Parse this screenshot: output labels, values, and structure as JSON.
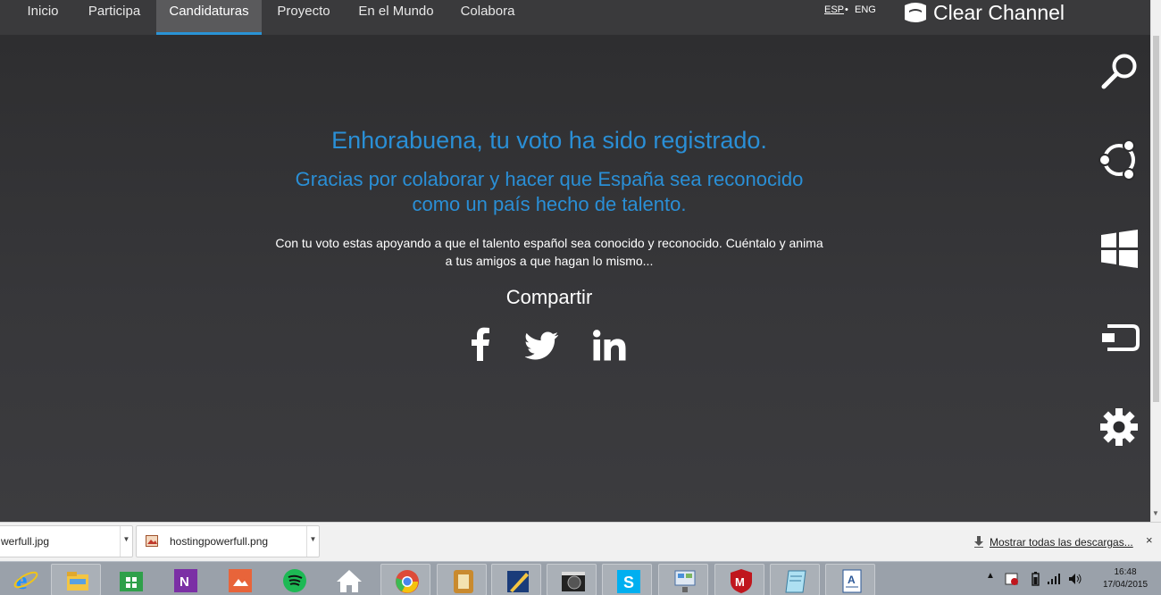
{
  "nav": {
    "items": [
      {
        "label": "Inicio"
      },
      {
        "label": "Participa"
      },
      {
        "label": "Candidaturas",
        "active": true
      },
      {
        "label": "Proyecto"
      },
      {
        "label": "En el Mundo"
      },
      {
        "label": "Colabora"
      }
    ],
    "lang_esp": "ESP",
    "lang_sep": "•",
    "lang_eng": "ENG",
    "brand": "Clear Channel"
  },
  "main": {
    "headline": "Enhorabuena, tu voto ha sido registrado.",
    "subhead_line1": "Gracias por colaborar y hacer que España sea reconocido",
    "subhead_line2": "como un país hecho de talento.",
    "body_line1": "Con tu voto estas apoyando a que el talento español sea conocido y reconocido. Cuéntalo y anima",
    "body_line2": "a tus amigos a que hagan lo mismo...",
    "share_label": "Compartir",
    "social": [
      "facebook-icon",
      "twitter-icon",
      "linkedin-icon"
    ]
  },
  "charms": [
    "search-icon",
    "share-icon",
    "start-icon",
    "devices-icon",
    "settings-icon"
  ],
  "downloads": {
    "items": [
      {
        "name": "werfull.jpg"
      },
      {
        "name": "hostingpowerfull.png"
      }
    ],
    "show_all": "Mostrar todas las descargas...",
    "close": "×"
  },
  "taskbar": {
    "apps": [
      "ie-icon",
      "explorer-icon",
      "store-icon",
      "onenote-icon",
      "photos-icon",
      "spotify-icon",
      "home-icon",
      "chrome-icon",
      "notes-icon",
      "editor-icon",
      "video-icon",
      "skype-icon",
      "network-icon",
      "mcafee-icon",
      "notepad-icon",
      "wordpad-icon"
    ],
    "time": "16:48",
    "date": "17/04/2015"
  },
  "colors": {
    "accent": "#2a8fd6",
    "nav_bg": "#3a3a3c",
    "main_bg": "#2e2e30",
    "taskbar_bg": "#9aa1aa"
  }
}
